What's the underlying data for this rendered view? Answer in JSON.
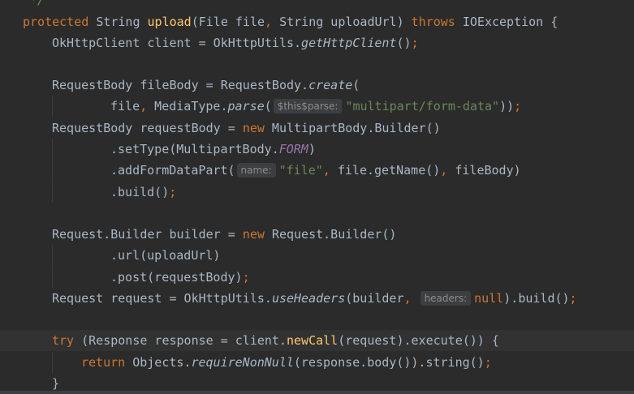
{
  "editor": {
    "comment_close": " */",
    "tok": {
      "protected": "protected",
      "String": "String",
      "upload": "upload",
      "lparen": "(",
      "rparen": ")",
      "File_file": "File file",
      "comma": ",",
      "String_uploadUrl": " String uploadUrl",
      "throws": "throws",
      "IOException": " IOException {",
      "OkHttpClient_client": "OkHttpClient client = OkHttpUtils.",
      "getHttpClient": "getHttpClient",
      "parens": "()",
      "semi": ";",
      "RequestBody_fileBody": "RequestBody fileBody = RequestBody.",
      "create": "create",
      "file": "file",
      "MediaType": " MediaType.",
      "parse": "parse",
      "hint_this_parse": "$this$parse:",
      "multipart": "\"multipart/form-data\"",
      "close2": "))",
      "RequestBody_requestBody": "RequestBody requestBody = ",
      "new": "new",
      "MultipartBody_Builder": " MultipartBody.Builder()",
      "setType": ".setType(MultipartBody.",
      "FORM": "FORM",
      "addFormDataPart": ".addFormDataPart(",
      "hint_name": "name:",
      "str_file": "\"file\"",
      "file_getName": " file.getName()",
      "fileBody_close": " fileBody)",
      "build": ".build()",
      "Request_Builder_builder": "Request.Builder builder = ",
      "Request_Builder": " Request.Builder()",
      "url": ".url(uploadUrl)",
      "post": ".post(requestBody)",
      "Request_request": "Request request = OkHttpUtils.",
      "useHeaders": "useHeaders",
      "builder_arg": "(builder",
      "hint_headers": "headers:",
      "null": "null",
      "close_build": ").build()",
      "try": "try",
      "Response": " (Response response = client.",
      "newCall": "newCall",
      "request_execute": "(request).execute()) {",
      "return": "return",
      "Objects": " Objects.",
      "requireNonNull": "requireNonNull",
      "body_string": "(response.body()).string()",
      "brace_close": "}"
    }
  }
}
